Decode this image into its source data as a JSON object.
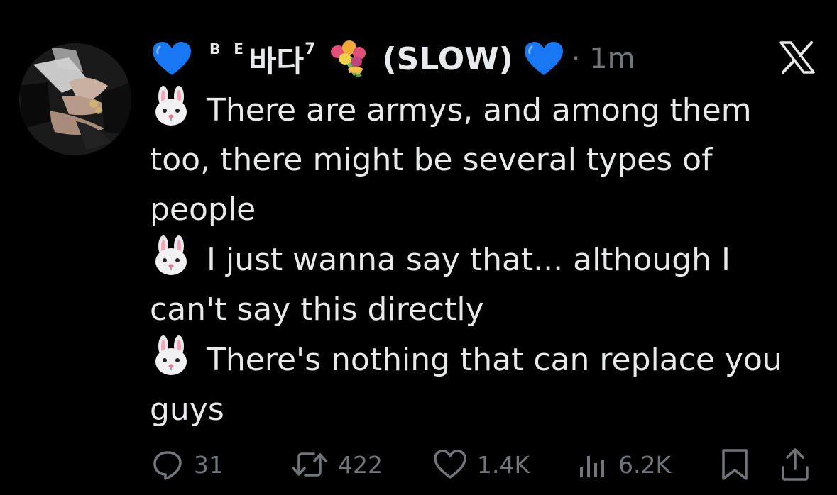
{
  "tweet": {
    "display_name_small": "B E",
    "display_name_main": "바다",
    "display_name_sup": "7",
    "display_name_tag": "(SLOW)",
    "timestamp": "· 1m",
    "lines": [
      "There are armys, and among them too, there might be several types of people",
      "I just wanna say that... although I can't say this directly",
      "There's nothing that can replace you guys"
    ],
    "platform_icon": "x-logo-icon",
    "emoji": {
      "heart": "blue-heart-emoji",
      "bouquet": "bouquet-emoji",
      "bunny": "rabbit-face-emoji"
    }
  },
  "actions": {
    "replies": "31",
    "reposts": "422",
    "likes": "1.4K",
    "views": "6.2K"
  },
  "colors": {
    "background": "#000000",
    "text_primary": "#e7e9ea",
    "text_secondary": "#71767b",
    "heart_blue": "#1877f2"
  }
}
